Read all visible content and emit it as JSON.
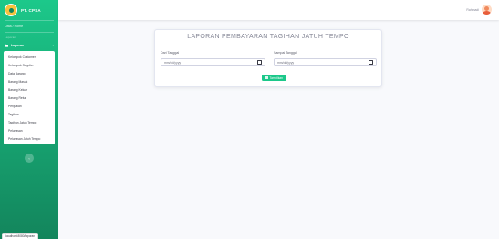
{
  "brand": {
    "name": "PT. CPSA"
  },
  "sidebar": {
    "dashboard_label": "Data / Home",
    "heading": "Laporan",
    "laporan_label": "Laporan",
    "items": [
      "Kelompok Customer",
      "Kelompok Supplier",
      "Data Barang",
      "Barang Masuk",
      "Barang Keluar",
      "Barang Retur",
      "Penjualan",
      "Tagihan",
      "Tagihan Jatuh Tempo",
      "Pelunasan",
      "Pelunasan Jatuh Tempo"
    ],
    "toggle_glyph": "‹"
  },
  "topbar": {
    "user_name": "Rahmadi"
  },
  "form": {
    "title": "LAPORAN PEMBAYARAN TAGIHAN JATUH TEMPO",
    "from_label": "Dari Tanggal",
    "to_label": "Sampai Tanggal",
    "from_value": "mm/dd/yyyy",
    "to_value": "mm/dd/yyyy",
    "button_label": "Tampilkan"
  },
  "status_bar": {
    "text": "localhost:8080/laporan"
  },
  "colors": {
    "primary": "#1cc88a",
    "sidebar_dark": "#13855c",
    "accent": "#f6c23e"
  }
}
